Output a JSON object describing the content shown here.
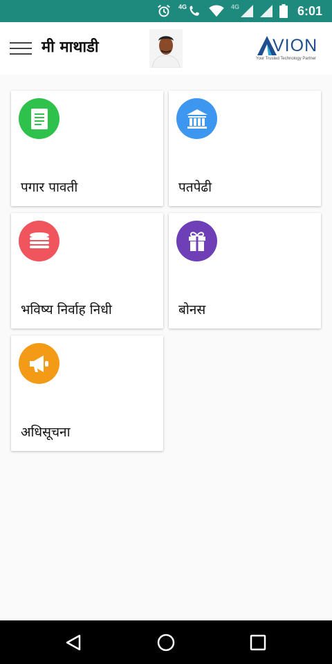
{
  "status_bar": {
    "time": "6:01",
    "network_1": "4G",
    "network_2": "4G",
    "icons": [
      "alarm-icon",
      "wifi-call-icon",
      "wifi-icon",
      "signal-icon",
      "signal-icon",
      "battery-icon"
    ]
  },
  "app_bar": {
    "title": "मी माथाडी",
    "menu_icon": "hamburger-menu-icon",
    "logo": {
      "name": "VION",
      "tagline": "Your Trusted Technology Partner"
    }
  },
  "tiles": [
    {
      "label": "पगार पावती",
      "icon": "document-icon",
      "color": "#2ec14b"
    },
    {
      "label": "पतपेढी",
      "icon": "bank-icon",
      "color": "#3d96f0"
    },
    {
      "label": "भविष्य निर्वाह निधी",
      "icon": "coins-icon",
      "color": "#f0545c"
    },
    {
      "label": "बोनस",
      "icon": "gift-icon",
      "color": "#6e3fb7"
    },
    {
      "label": "अधिसूचना",
      "icon": "megaphone-icon",
      "color": "#f39b16"
    }
  ],
  "nav_bar": {
    "icons": [
      "back-icon",
      "home-icon",
      "recents-icon"
    ]
  },
  "colors": {
    "status_bar": "#1e8a7e",
    "background": "#fafafa"
  }
}
